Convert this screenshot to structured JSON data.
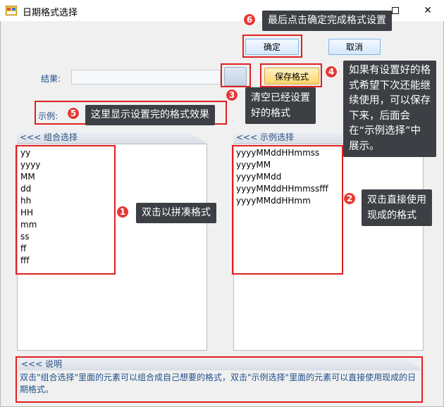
{
  "window": {
    "title": "日期格式选择",
    "minimize_glyph": "—",
    "close_glyph": "✕"
  },
  "buttons": {
    "confirm": "确定",
    "cancel": "取消",
    "clear": "",
    "save_format": "保存格式"
  },
  "result": {
    "label": "结果:",
    "value": ""
  },
  "example": {
    "label": "示例:"
  },
  "combo_panel": {
    "header": "<<< 组合选择",
    "items": [
      "yy",
      "yyyy",
      "MM",
      "dd",
      "hh",
      "HH",
      "mm",
      "ss",
      "ff",
      "fff"
    ]
  },
  "sample_panel": {
    "header": "<<< 示例选择",
    "items": [
      "yyyyMMddHHmmss",
      "yyyyMM",
      "yyyyMMdd",
      "yyyyMMddHHmmssfff",
      "yyyyMMddHHmm"
    ]
  },
  "description": {
    "header": "<<< 说明",
    "text": "双击\"组合选择\"里面的元素可以组合成自己想要的格式，双击\"示例选择\"里面的元素可以直接使用现成的日期格式。"
  },
  "annotations": [
    {
      "number": "1",
      "text": "双击以拼凑格式"
    },
    {
      "number": "2",
      "line1": "双击直接使用",
      "line2": "现成的格式"
    },
    {
      "number": "3",
      "line1": "清空已经设置",
      "line2": "好的格式"
    },
    {
      "number": "4",
      "line1": "如果有设置好的格",
      "line2": "式希望下次还能继",
      "line3": "续使用，可以保存",
      "line4": "下来，后面会",
      "line5": "在“示例选择”中",
      "line6": "展示。"
    },
    {
      "number": "5",
      "text": "这里显示设置完的格式效果"
    },
    {
      "number": "6",
      "text": "最后点击确定完成格式设置"
    }
  ],
  "colors": {
    "annotation_red": "#e02020",
    "tooltip_bg": "#3c3f43",
    "label_blue": "#1f4e8c",
    "save_button": "#ffd56a"
  }
}
